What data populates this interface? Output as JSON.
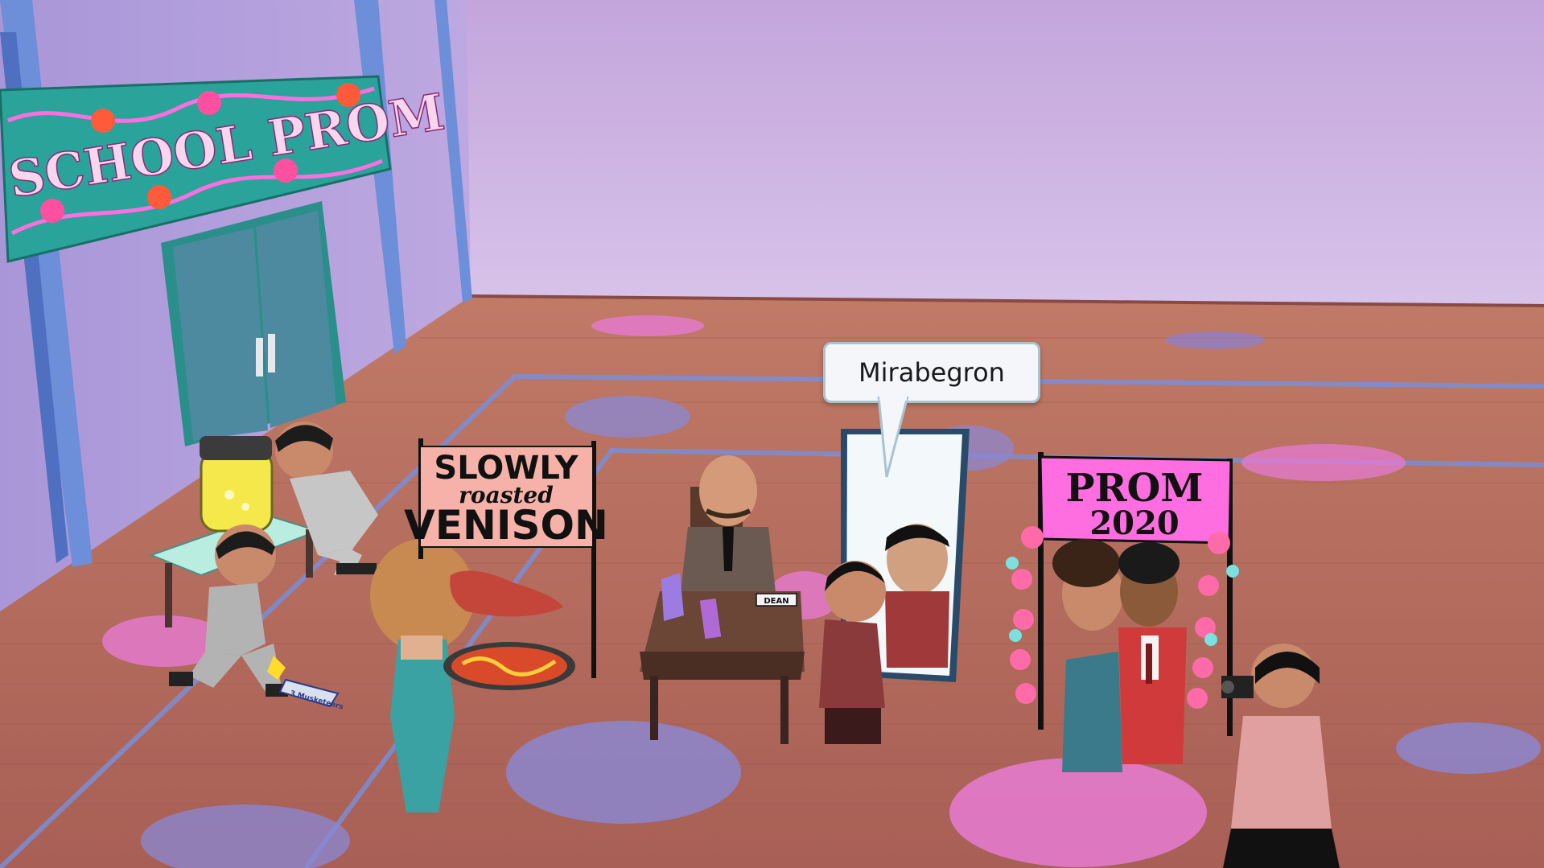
{
  "banner": {
    "text": "SCHOOL PROM"
  },
  "venison_sign": {
    "line1": "SLOWLY",
    "line2": "roasted",
    "line3": "VENISON"
  },
  "prom_sign": {
    "line1": "PROM",
    "line2": "2020"
  },
  "dean_plate": {
    "text": "DEAN"
  },
  "candy_bar": {
    "text": "3 Musketeers"
  },
  "speech_bubble": {
    "text": "Mirabegron"
  },
  "colors": {
    "wall": "#c4a6da",
    "floor": "#b6695c",
    "banner": "#2aa39a",
    "prom_sign": "#ff6ee0"
  }
}
